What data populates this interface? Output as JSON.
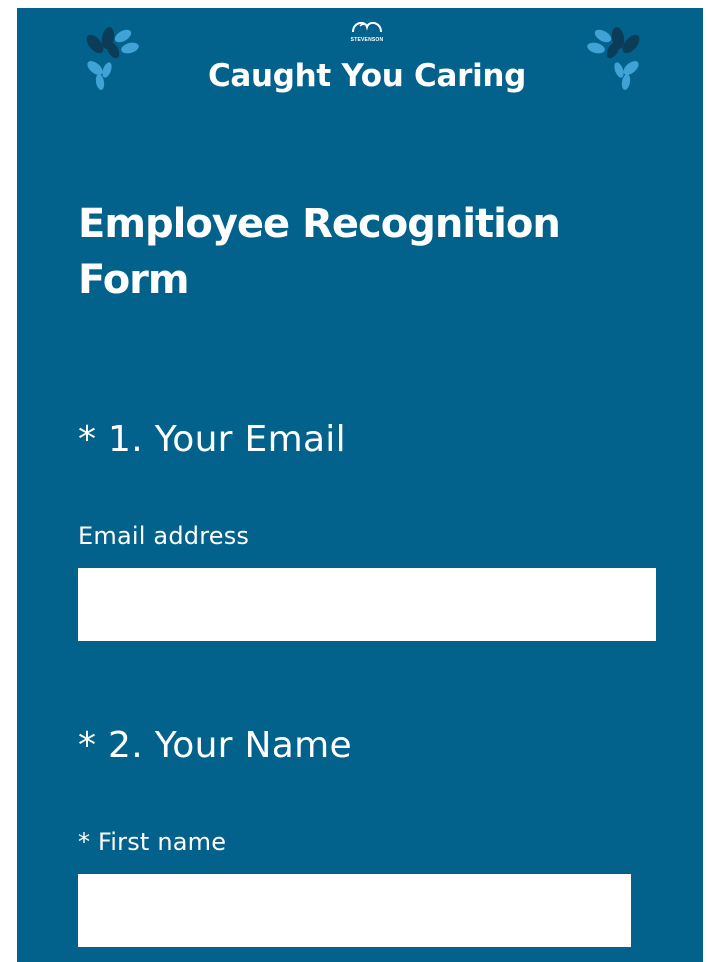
{
  "brand": {
    "logo_text": "STEVENSON",
    "title": "Caught You Caring"
  },
  "colors": {
    "background": "#03628c",
    "leaf_dark": "#0b3c58",
    "leaf_light": "#3fa3d6"
  },
  "form": {
    "title": "Employee Recognition Form",
    "questions": [
      {
        "label": "* 1. Your Email",
        "fields": [
          {
            "label": "Email address",
            "value": "",
            "placeholder": ""
          }
        ]
      },
      {
        "label": "* 2. Your Name",
        "fields": [
          {
            "label": "* First name",
            "value": "",
            "placeholder": ""
          }
        ]
      }
    ]
  }
}
